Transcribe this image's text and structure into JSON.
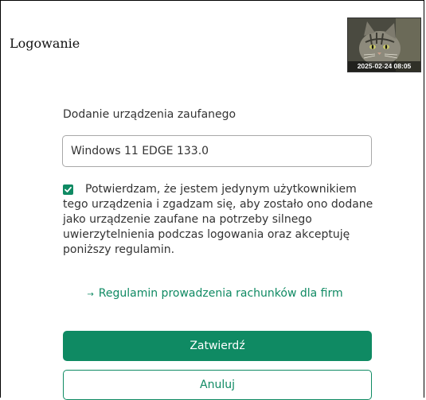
{
  "header": {
    "title": "Logowanie",
    "thumbnail": {
      "timestamp": "2025-02-24 08:05",
      "icon": "cat-photo"
    }
  },
  "form": {
    "label": "Dodanie urządzenia zaufanego",
    "device_input": {
      "value": "Windows 11 EDGE 133.0"
    },
    "consent": {
      "checked": true,
      "text": "Potwierdzam, że jestem jedynym użytkownikiem tego urządzenia i zgadzam się, aby zostało ono dodane jako urządzenie zaufane na potrzeby silnego uwierzytelnienia podczas logowania oraz akceptuję poniższy regulamin."
    },
    "terms_link": {
      "icon": "arrow-right-icon",
      "label": "Regulamin prowadzenia rachunków dla firm"
    },
    "confirm_label": "Zatwierdź",
    "cancel_label": "Anuluj"
  },
  "colors": {
    "accent": "#0f8a63",
    "text": "#333333",
    "border": "#a8a8a8"
  }
}
